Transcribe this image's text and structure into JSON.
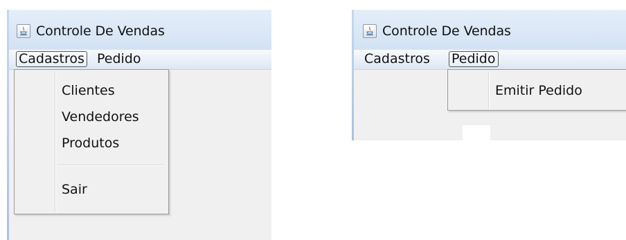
{
  "windows": [
    {
      "title": "Controle De Vendas",
      "menus": [
        {
          "label": "Cadastros",
          "active": true
        },
        {
          "label": "Pedido",
          "active": false
        }
      ],
      "dropdown": {
        "items": [
          {
            "label": "Clientes"
          },
          {
            "label": "Vendedores"
          },
          {
            "label": "Produtos"
          },
          {
            "label": "Sair"
          }
        ]
      }
    },
    {
      "title": "Controle De Vendas",
      "menus": [
        {
          "label": "Cadastros",
          "active": false
        },
        {
          "label": "Pedido",
          "active": true
        }
      ],
      "dropdown": {
        "items": [
          {
            "label": "Emitir Pedido"
          }
        ]
      }
    }
  ],
  "icons": {
    "app": "java-cup-icon"
  },
  "colors": {
    "titlebar": "#dbe7f5",
    "menubar": "#e8eef6",
    "window_bg": "#f0f0f0",
    "menu_border": "#9a9a9a"
  }
}
